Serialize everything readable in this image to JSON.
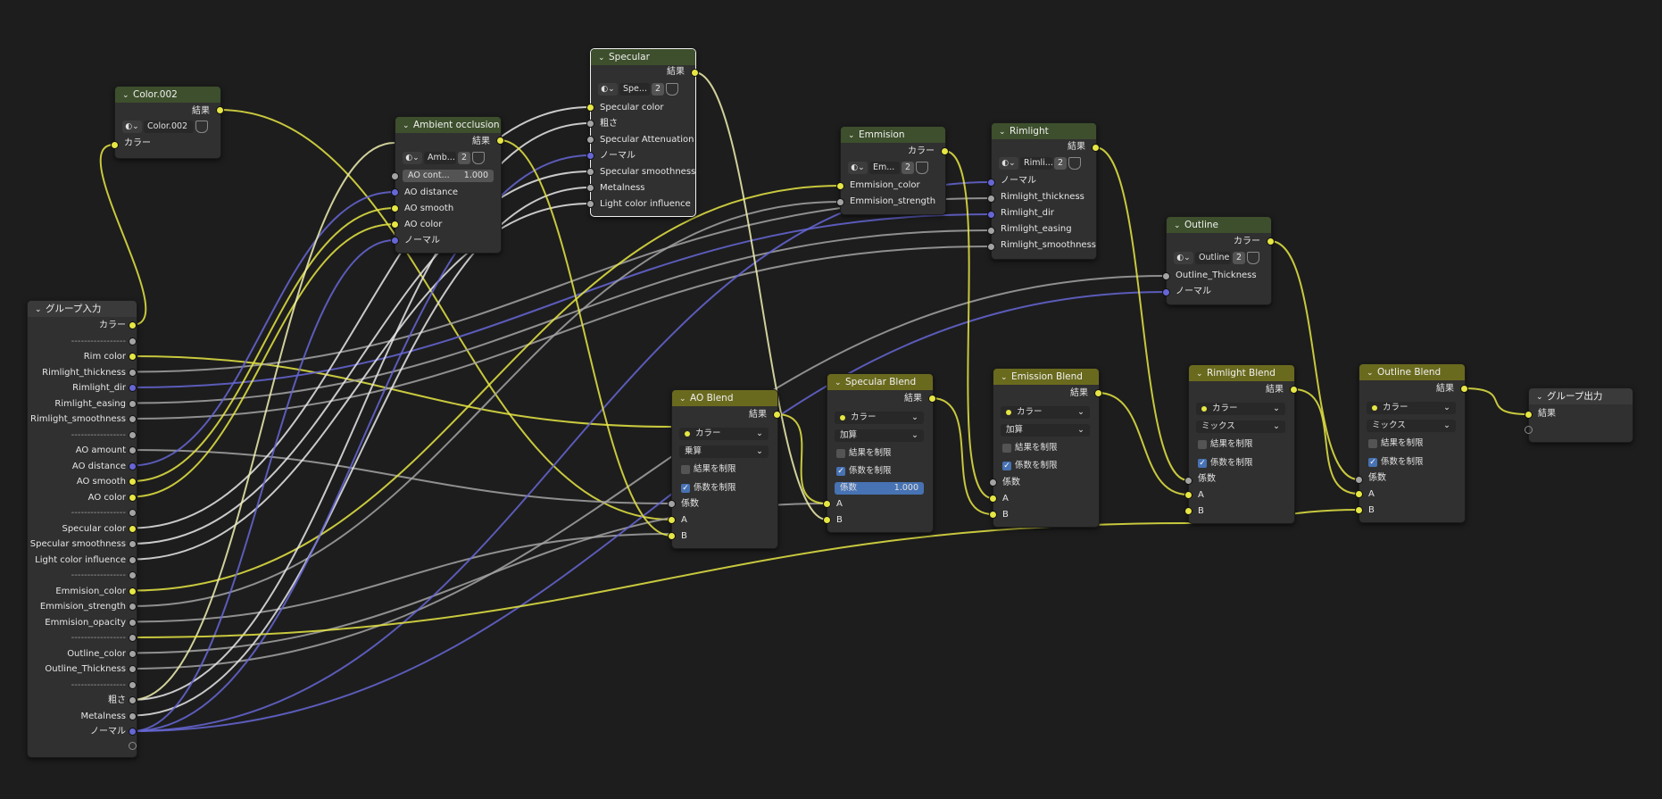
{
  "colors": {
    "yellow": "#e6e644",
    "gray": "#a3a3a3",
    "blue": "#6666d6",
    "white": "#e8e8e8",
    "pale": "#f0f0b0"
  },
  "nodes": {
    "color002": {
      "title": "Color.002",
      "output": "結果",
      "image": "Color.002",
      "input": "カラー"
    },
    "ao": {
      "title": "Ambient occlusion",
      "output": "結果",
      "image": "Amb...",
      "users": "2",
      "field_label": "AO cont...",
      "field_value": "1.000",
      "inputs": [
        "AO distance",
        "AO smooth",
        "AO color",
        "ノーマル"
      ]
    },
    "specular": {
      "title": "Specular",
      "output": "結果",
      "image": "Spe...",
      "users": "2",
      "inputs": [
        "Specular color",
        "粗さ",
        "Specular Attenuation",
        "ノーマル",
        "Specular smoothness",
        "Metalness",
        "Light color influence"
      ]
    },
    "emission": {
      "title": "Emmision",
      "output": "カラー",
      "image": "Em...",
      "users": "2",
      "inputs": [
        "Emmision_color",
        "Emmision_strength"
      ]
    },
    "rimlight": {
      "title": "Rimlight",
      "output": "結果",
      "image": "Rimli...",
      "users": "2",
      "inputs": [
        "ノーマル",
        "Rimlight_thickness",
        "Rimlight_dir",
        "Rimlight_easing",
        "Rimlight_smoothness"
      ]
    },
    "outline": {
      "title": "Outline",
      "output": "カラー",
      "image": "Outline",
      "users": "2",
      "inputs": [
        "Outline_Thickness",
        "ノーマル"
      ]
    },
    "group_input": {
      "title": "グループ入力",
      "outputs": [
        "カラー",
        "-----------------",
        "Rim color",
        "Rimlight_thickness",
        "Rimlight_dir",
        "Rimlight_easing",
        "Rimlight_smoothness",
        "-----------------",
        "AO amount",
        "AO distance",
        "AO smooth",
        "AO color",
        "-----------------",
        "Specular color",
        "Specular smoothness",
        "Light color influence",
        "-----------------",
        "Emmision_color",
        "Emmision_strength",
        "Emmision_opacity",
        "-----------------",
        "Outline_color",
        "Outline_Thickness",
        "-----------------",
        "粗さ",
        "Metalness",
        "ノーマル"
      ]
    },
    "ao_blend": {
      "title": "AO Blend",
      "output": "結果",
      "data_type": "カラー",
      "blend": "乗算",
      "clamp_result": "結果を制限",
      "clamp_factor": "係数を制限",
      "fac": "係数",
      "a": "A",
      "b": "B"
    },
    "spec_blend": {
      "title": "Specular Blend",
      "output": "結果",
      "data_type": "カラー",
      "blend": "加算",
      "clamp_result": "結果を制限",
      "clamp_factor": "係数を制限",
      "fac": "係数",
      "fac_value": "1.000",
      "a": "A",
      "b": "B"
    },
    "emis_blend": {
      "title": "Emission Blend",
      "output": "結果",
      "data_type": "カラー",
      "blend": "加算",
      "clamp_result": "結果を制限",
      "clamp_factor": "係数を制限",
      "fac": "係数",
      "a": "A",
      "b": "B"
    },
    "rim_blend": {
      "title": "Rimlight Blend",
      "output": "結果",
      "data_type": "カラー",
      "blend": "ミックス",
      "clamp_result": "結果を制限",
      "clamp_factor": "係数を制限",
      "fac": "係数",
      "a": "A",
      "b": "B"
    },
    "out_blend": {
      "title": "Outline Blend",
      "output": "結果",
      "data_type": "カラー",
      "blend": "ミックス",
      "clamp_result": "結果を制限",
      "clamp_factor": "係数を制限",
      "fac": "係数",
      "a": "A",
      "b": "B"
    },
    "group_output": {
      "title": "グループ出力",
      "input": "結果"
    }
  }
}
